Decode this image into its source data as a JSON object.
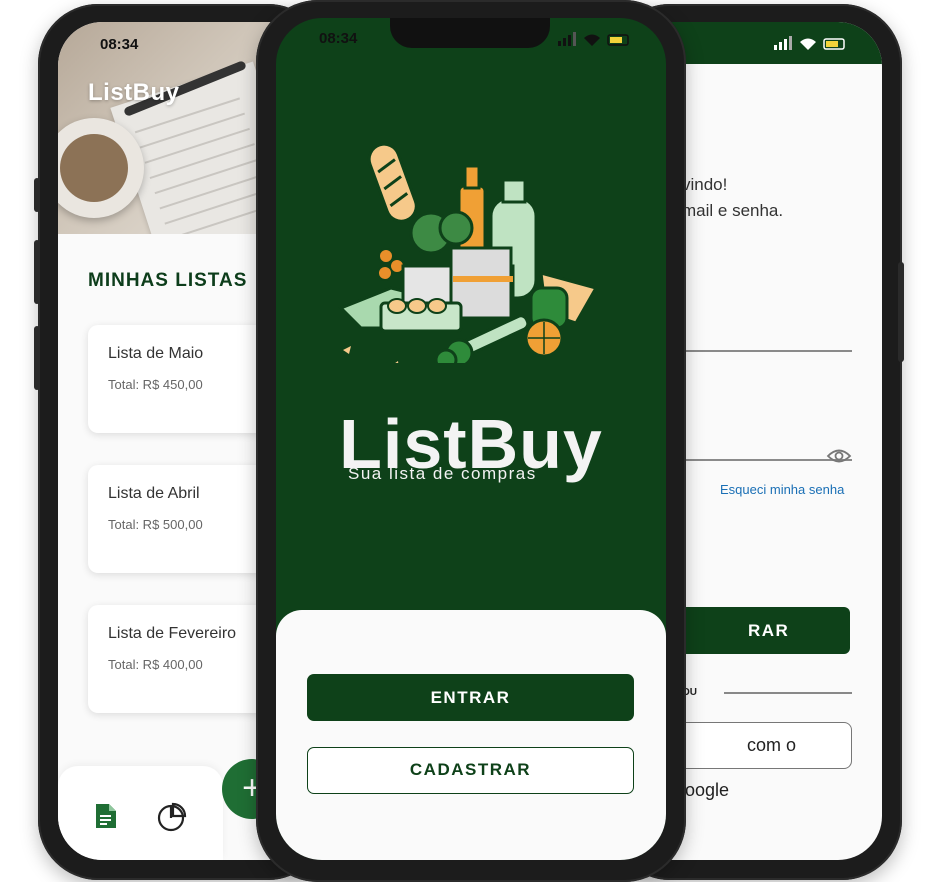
{
  "status_bar": {
    "time_left": "08:34",
    "time_center": "08:34"
  },
  "left_screen": {
    "app_title": "ListBuy",
    "section_title": "MINHAS LISTAS",
    "lists": [
      {
        "name": "Lista de Maio",
        "total": "Total: R$ 450,00"
      },
      {
        "name": "Lista de Abril",
        "total": "Total: R$ 500,00"
      },
      {
        "name": "Lista de Fevereiro",
        "total": "Total: R$ 400,00"
      }
    ],
    "fab_label": "+"
  },
  "center_screen": {
    "logo": "ListBuy",
    "slogan": "Sua lista de compras",
    "enter_button": "ENTRAR",
    "signup_button": "CADASTRAR"
  },
  "right_screen": {
    "greeting_line1": "vindo!",
    "greeting_line2": "mail e senha.",
    "forgot_link": "Esqueci minha senha",
    "enter_button_partial": "RAR",
    "or_label": "OU",
    "google_button_partial": "com o Google"
  },
  "colors": {
    "brand_green": "#0e4119",
    "fab_green": "#1f6e34",
    "link_blue": "#1a6fb5"
  }
}
